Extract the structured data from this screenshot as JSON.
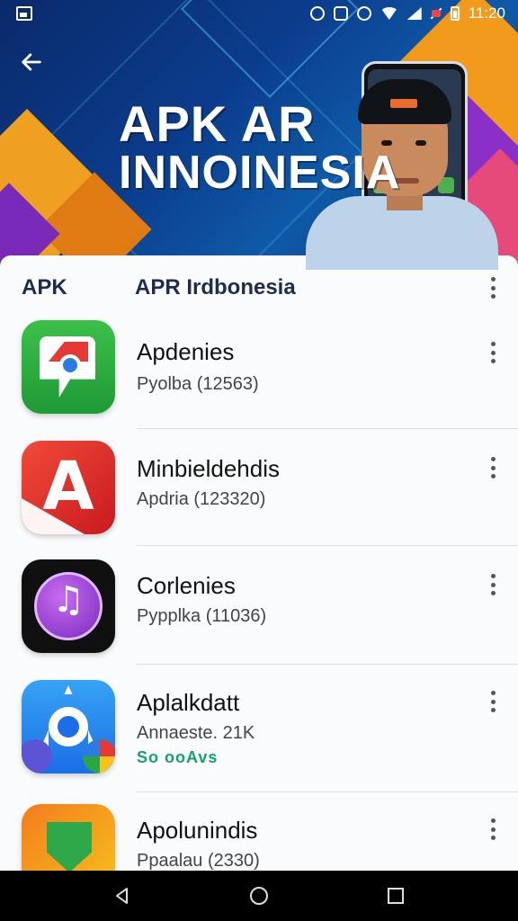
{
  "status_bar": {
    "time": "11:20"
  },
  "banner": {
    "title_line1": "APK AR",
    "title_line2": "INNOINESIA"
  },
  "section": {
    "left_label": "APK",
    "title": "APR Irdbonesia"
  },
  "apps": [
    {
      "name": "Apdenies",
      "subtitle": "Pyolba (12563)",
      "extra": "",
      "icon": "maps-icon",
      "color": "#2aa83c"
    },
    {
      "name": "Minbieldehdis",
      "subtitle": "Apdria (123320)",
      "extra": "",
      "icon": "letter-a-icon",
      "color": "#e53935"
    },
    {
      "name": "Corlenies",
      "subtitle": "Pypplka (11036)",
      "extra": "",
      "icon": "music-note-icon",
      "color": "#8a3ad0"
    },
    {
      "name": "Aplalkdatt",
      "subtitle": "Annaeste. 21K",
      "extra": "So ooAvs",
      "icon": "navigation-icon",
      "color": "#1c6ee6"
    },
    {
      "name": "Apolunindis",
      "subtitle": "Ppaalau (2330)",
      "extra": "",
      "icon": "shield-icon",
      "color": "#f47c1e"
    }
  ],
  "icon_glyphs": {
    "letter_a": "A",
    "music_note": "♫"
  }
}
